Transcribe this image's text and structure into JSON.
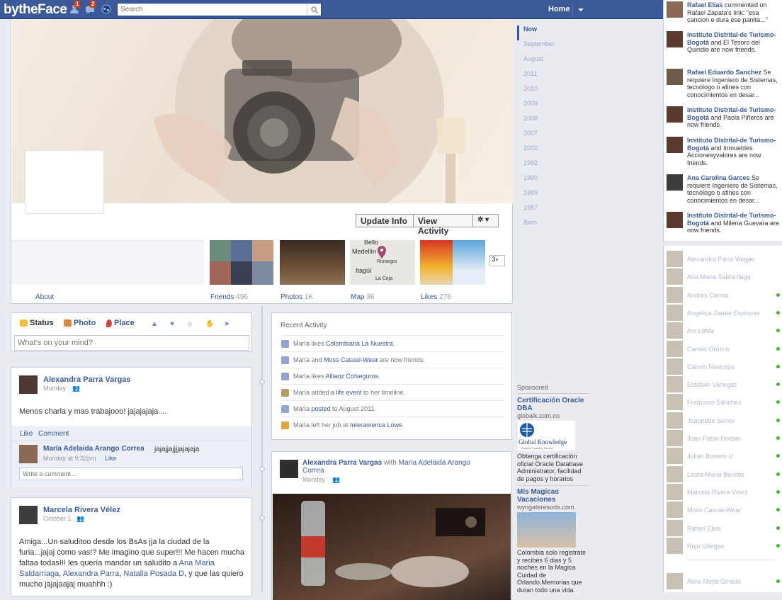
{
  "topbar": {
    "logo": "bytheFace",
    "friend_requests_count": "1",
    "messages_count": "2",
    "search_placeholder": "Search",
    "home_label": "Home"
  },
  "profile": {
    "update_info_label": "Update Info",
    "view_activity_label": "View Activity"
  },
  "tabs": [
    {
      "label": "About",
      "count": ""
    },
    {
      "label": "Friends",
      "count": "496"
    },
    {
      "label": "Photos",
      "count": "1K"
    },
    {
      "label": "Map",
      "count": "36"
    },
    {
      "label": "Likes",
      "count": "276"
    }
  ],
  "tabs_more": "3",
  "map_labels": {
    "bello": "Bello",
    "medellin": "Medellín",
    "rionegro": "Rionegro",
    "itagui": "Itagüí",
    "laceja": "La Ceja"
  },
  "scrubber": [
    "Now",
    "September",
    "August",
    "2011",
    "2010",
    "2009",
    "2008",
    "2007",
    "2002",
    "1992",
    "1990",
    "1989",
    "1987",
    "Born"
  ],
  "composer": {
    "status": "Status",
    "photo": "Photo",
    "place": "Place",
    "placeholder": "What's on your mind?"
  },
  "post1": {
    "author": "Alexandra Parra Vargas",
    "time": "Monday",
    "text": "Menos charla y mas trabajooo! jajajajaja....",
    "like": "Like",
    "comment": "Comment",
    "c_author": "María Adelaida Arango Correa",
    "c_text": "jajajjajjjjajajaja",
    "c_time": "Monday at 9:32pm",
    "c_like": "Like",
    "write_comment": "Write a comment..."
  },
  "post2": {
    "author": "Marcela Rivera Vélez",
    "time": "October 1",
    "text1": "Amiga...Un saluditoo desde los BsAs jja la ciudad de la furia...jajaj como vas!? Me imagino que super!!! Me hacen mucha faltaa todas!!! les quería mandar un saludito a",
    "link1": "Ana Maria Saldarriaga",
    "link2": "Alexandra Parra",
    "link3": "Natalia Posada D",
    "text2": ", y que las quiero mucho jajajaajaj muahhh :)"
  },
  "recent": {
    "title": "Recent Activity",
    "items": [
      {
        "pre": "María likes ",
        "link": "Colombiana La Nuestra",
        "post": "."
      },
      {
        "pre": "María and ",
        "link": "Moss Casual-Wear",
        "post": " are now friends."
      },
      {
        "pre": "María likes ",
        "link": "Allianz Colseguros",
        "post": "."
      },
      {
        "pre": "María added ",
        "link": "a life event",
        "post": " to her timeline."
      },
      {
        "pre": "María ",
        "link": "posted",
        "post": " to August 2011."
      },
      {
        "pre": "María left her job at ",
        "link": "Interamerica Lowe",
        "post": "."
      }
    ]
  },
  "post3": {
    "author": "Alexandra Parra Vargas",
    "with": " with ",
    "tagged": "María Adelaida Arango Correa",
    "time": "Monday"
  },
  "ads": {
    "heading": "Sponsored",
    "ad1": {
      "title": "Certificación Oracle DBA",
      "url": "globalk.com.co",
      "brand": "Global Knowledge",
      "tagline": "Experts Teaching Experts",
      "text": "Obtenga certificación oficial Oracle Database Administrator, facilidad de pagos y horarios"
    },
    "ad2": {
      "title": "Mis Magicas Vacaciones",
      "url": "wyngateresorts.com",
      "text": "Colombia solo registrate y recibes 6 dias y 5 noches en la Magica Cuidad de Orlando.Memorias que duran todo una vida."
    }
  },
  "ticker": [
    {
      "name": "Rafael Elias",
      "text": " commented on Rafael Zapata's link: \"esa cancion e dura ese panita...\""
    },
    {
      "name": "Instituto Distrital-de Turismo-Bogotá",
      "text": " and El Tesoro del Quindio are now friends."
    },
    {
      "name": "Rafael Eduardo Sanchez",
      "text": " Se requiere Ingeniero de Sistemas, tecnólogo o afines con conocimientos en desar..."
    },
    {
      "name": "Instituto Distrital-de Turismo-Bogotá",
      "text": " and Paola Piñeros are now friends."
    },
    {
      "name": "Instituto Distrital-de Turismo-Bogotá",
      "text": " and Inmuebles Accionesyvalores are now friends."
    },
    {
      "name": "Ana Carolina Garces",
      "text": " Se requiere Ingeniero de Sistemas, tecnólogo o afines con conocimientos en desar..."
    },
    {
      "name": "Instituto Distrital-de Turismo-Bogotá",
      "text": " and Milena Guevara are now friends."
    }
  ],
  "chat": [
    {
      "name": "Alexandra Parra Vargas",
      "online": false
    },
    {
      "name": "Ana Maria Saldarriaga",
      "online": false
    },
    {
      "name": "Andres Correa",
      "online": true
    },
    {
      "name": "Angelica Zarate Espinosa",
      "online": true
    },
    {
      "name": "Ani LoMa",
      "online": true
    },
    {
      "name": "Camilo Orozco",
      "online": true
    },
    {
      "name": "Camilo Restrepo",
      "online": true
    },
    {
      "name": "Esteban Vanegas",
      "online": true
    },
    {
      "name": "Francisco Sanchez",
      "online": true
    },
    {
      "name": "Jeannette Senior",
      "online": true
    },
    {
      "name": "Juan Pablo Roldan",
      "online": true
    },
    {
      "name": "Julian Borrero U",
      "online": true
    },
    {
      "name": "Laura María Benitez",
      "online": true
    },
    {
      "name": "Marcela Rivera Vélez",
      "online": true
    },
    {
      "name": "Moss Casual-Wear",
      "online": true
    },
    {
      "name": "Rafael Elias",
      "online": true
    },
    {
      "name": "Rojo Villegas",
      "online": true
    },
    {
      "name": "Aline Mejía Giraldo",
      "online": true
    }
  ]
}
